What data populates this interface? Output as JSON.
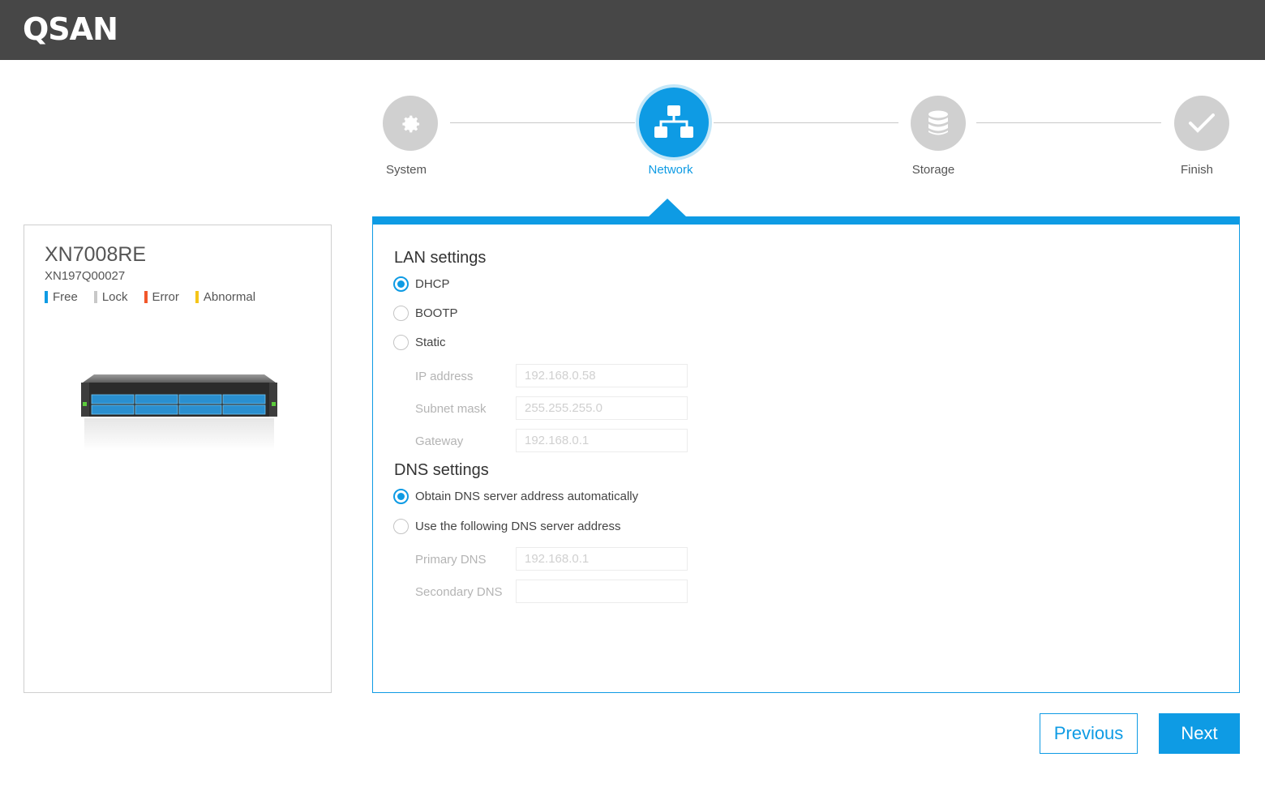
{
  "app": {
    "logo": "QSAN"
  },
  "stepper": {
    "steps": [
      {
        "label": "System",
        "icon": "gear-icon",
        "state": "done"
      },
      {
        "label": "Network",
        "icon": "network-icon",
        "state": "active"
      },
      {
        "label": "Storage",
        "icon": "database-icon",
        "state": "pending"
      },
      {
        "label": "Finish",
        "icon": "check-icon",
        "state": "pending"
      }
    ]
  },
  "device": {
    "model": "XN7008RE",
    "serial": "XN197Q00027",
    "legend": [
      {
        "label": "Free",
        "color": "#0e9be4"
      },
      {
        "label": "Lock",
        "color": "#c8c8c8"
      },
      {
        "label": "Error",
        "color": "#f2572a"
      },
      {
        "label": "Abnormal",
        "color": "#f5c519"
      }
    ]
  },
  "lan": {
    "title": "LAN settings",
    "options": [
      {
        "label": "DHCP",
        "checked": true
      },
      {
        "label": "BOOTP",
        "checked": false
      },
      {
        "label": "Static",
        "checked": false
      }
    ],
    "fields": [
      {
        "label": "IP address",
        "value": "192.168.0.58"
      },
      {
        "label": "Subnet mask",
        "value": "255.255.255.0"
      },
      {
        "label": "Gateway",
        "value": "192.168.0.1"
      }
    ]
  },
  "dns": {
    "title": "DNS settings",
    "options": [
      {
        "label": "Obtain DNS server address automatically",
        "checked": true
      },
      {
        "label": "Use the following DNS server address",
        "checked": false
      }
    ],
    "fields": [
      {
        "label": "Primary DNS",
        "value": "192.168.0.1"
      },
      {
        "label": "Secondary DNS",
        "value": ""
      }
    ]
  },
  "actions": {
    "previous": "Previous",
    "next": "Next"
  },
  "colors": {
    "accent": "#0e9be4",
    "header": "#474747",
    "inactive_step": "#d0d0d0"
  }
}
